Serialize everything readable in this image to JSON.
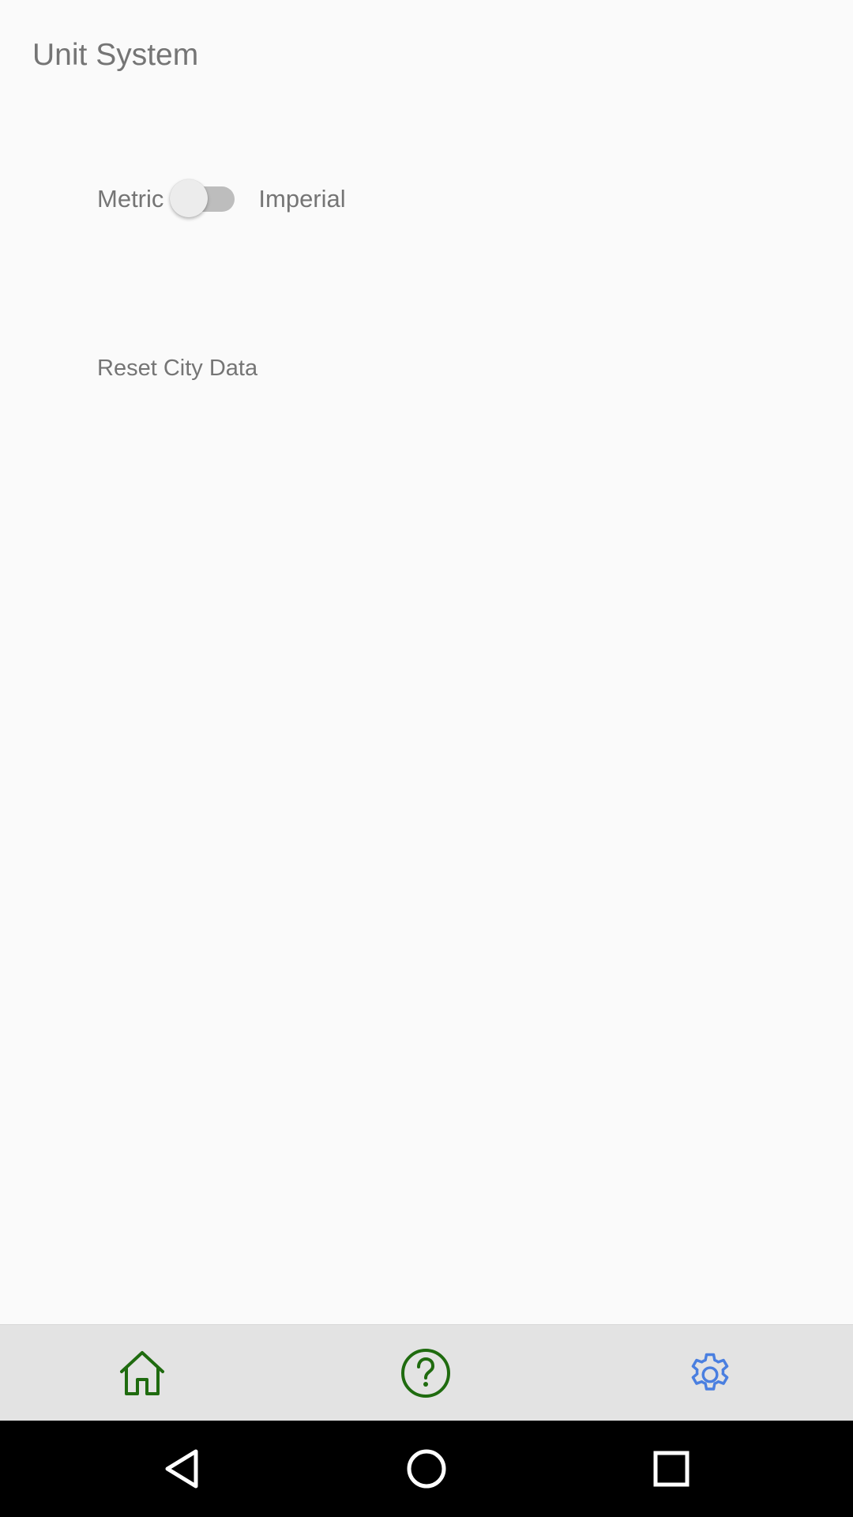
{
  "settings": {
    "section_title": "Unit System",
    "unit_toggle": {
      "left_label": "Metric",
      "right_label": "Imperial",
      "is_on": false
    },
    "reset_label": "Reset City Data"
  },
  "bottom_nav": {
    "items": [
      {
        "icon": "home-icon",
        "color": "#1f6b0f"
      },
      {
        "icon": "help-icon",
        "color": "#1f6b0f"
      },
      {
        "icon": "gear-icon",
        "color": "#4a7fe0",
        "active": true
      }
    ]
  },
  "system_nav": {
    "items": [
      {
        "icon": "back-icon"
      },
      {
        "icon": "home-circle-icon"
      },
      {
        "icon": "recents-icon"
      }
    ]
  },
  "colors": {
    "background": "#fafafa",
    "text_secondary": "#757575",
    "nav_background": "#e3e3e3",
    "nav_inactive": "#1f6b0f",
    "nav_active": "#4a7fe0",
    "system_bar": "#000000"
  }
}
